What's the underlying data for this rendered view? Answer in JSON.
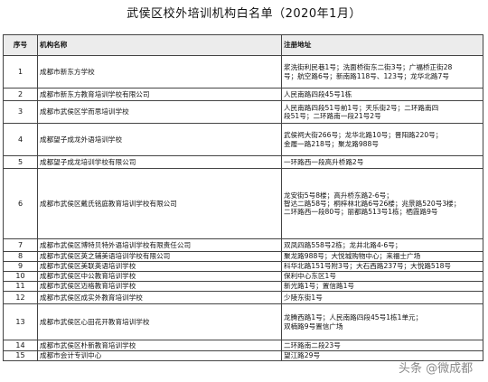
{
  "title": "武侯区校外培训机构白名单（2020年1月）",
  "columns": [
    "序号",
    "机构名称",
    "注册地址"
  ],
  "rows": [
    {
      "no": "1",
      "name": "成都市新东方学校",
      "address": [
        "浆洗街利民巷1号；洗面桥街东二街3号；广福桥正街28",
        "号；航空路6号；新南路118号、123号；龙华北路7号"
      ]
    },
    {
      "no": "2",
      "name": "成都市新东方教育培训学校有限公司",
      "address": [
        "人民南路四段45号1栋"
      ]
    },
    {
      "no": "3",
      "name": "成都市武侯区学而思培训学校",
      "address": [
        "人民南路四段51号前1号；天乐街2号；二环路南四",
        "段51号；二环路南一段21号2号"
      ]
    },
    {
      "no": "4",
      "name": "成都望子成龙外语培训学校",
      "address": [
        "武侯祠大街266号；龙华北路10号；晋阳路220号；",
        "金履一路218号；聚龙路988号"
      ]
    },
    {
      "no": "5",
      "name": "成都望子成龙培训学校有限公司",
      "address": [
        "一环路西一段高升桥路2号"
      ]
    },
    {
      "no": "6",
      "name": "成都市武侯区戴氏铭庭教育培训学校有限公司",
      "address": [
        "龙安街5号8楼；高升桥东路2-6号；",
        "智达二路58号；桐梓林北路6号26楼；兆景路520号3楼；",
        "二环路西一段80号；丽都路513号1栋；栖霞路9号"
      ]
    },
    {
      "no": "7",
      "name": "成都市武侯区博特贝特外语培训学校有限责任公司",
      "address": [
        "双凤四路558号2栋；龙井北路4-6号；"
      ]
    },
    {
      "no": "8",
      "name": "成都市武侯区英之辅美语培训学校有限公司",
      "address": [
        "聚龙路988号；大悦城购物中心；来福士广场"
      ]
    },
    {
      "no": "9",
      "name": "成都市武侯区美联英语培训学校",
      "address": [
        "科华北路151号附3号；大石西路237号；大悦路518号"
      ]
    },
    {
      "no": "10",
      "name": "成都市武侯区中公教育培训学校",
      "address": [
        "保利中心东区1号"
      ]
    },
    {
      "no": "11",
      "name": "成都市武侯区迈格教育培训学校",
      "address": [
        "新光路1号；置信路1号"
      ]
    },
    {
      "no": "12",
      "name": "成都市武侯区成实外教育培训学校",
      "address": [
        "少陵东街1号"
      ]
    },
    {
      "no": "13",
      "name": "成都市武侯区心田花开教育培训学校",
      "address": [
        "龙腾西路1号；人民南路四段45号1栋1单元；",
        "双楠路9号置信广场"
      ]
    },
    {
      "no": "14",
      "name": "成都市武侯区朴新教育培训学校",
      "address": [
        "二环路南二段23号"
      ]
    },
    {
      "no": "15",
      "name": "成都市会计专训中心",
      "address": [
        "望江路29号"
      ]
    }
  ],
  "watermark": "头条 @微成都"
}
